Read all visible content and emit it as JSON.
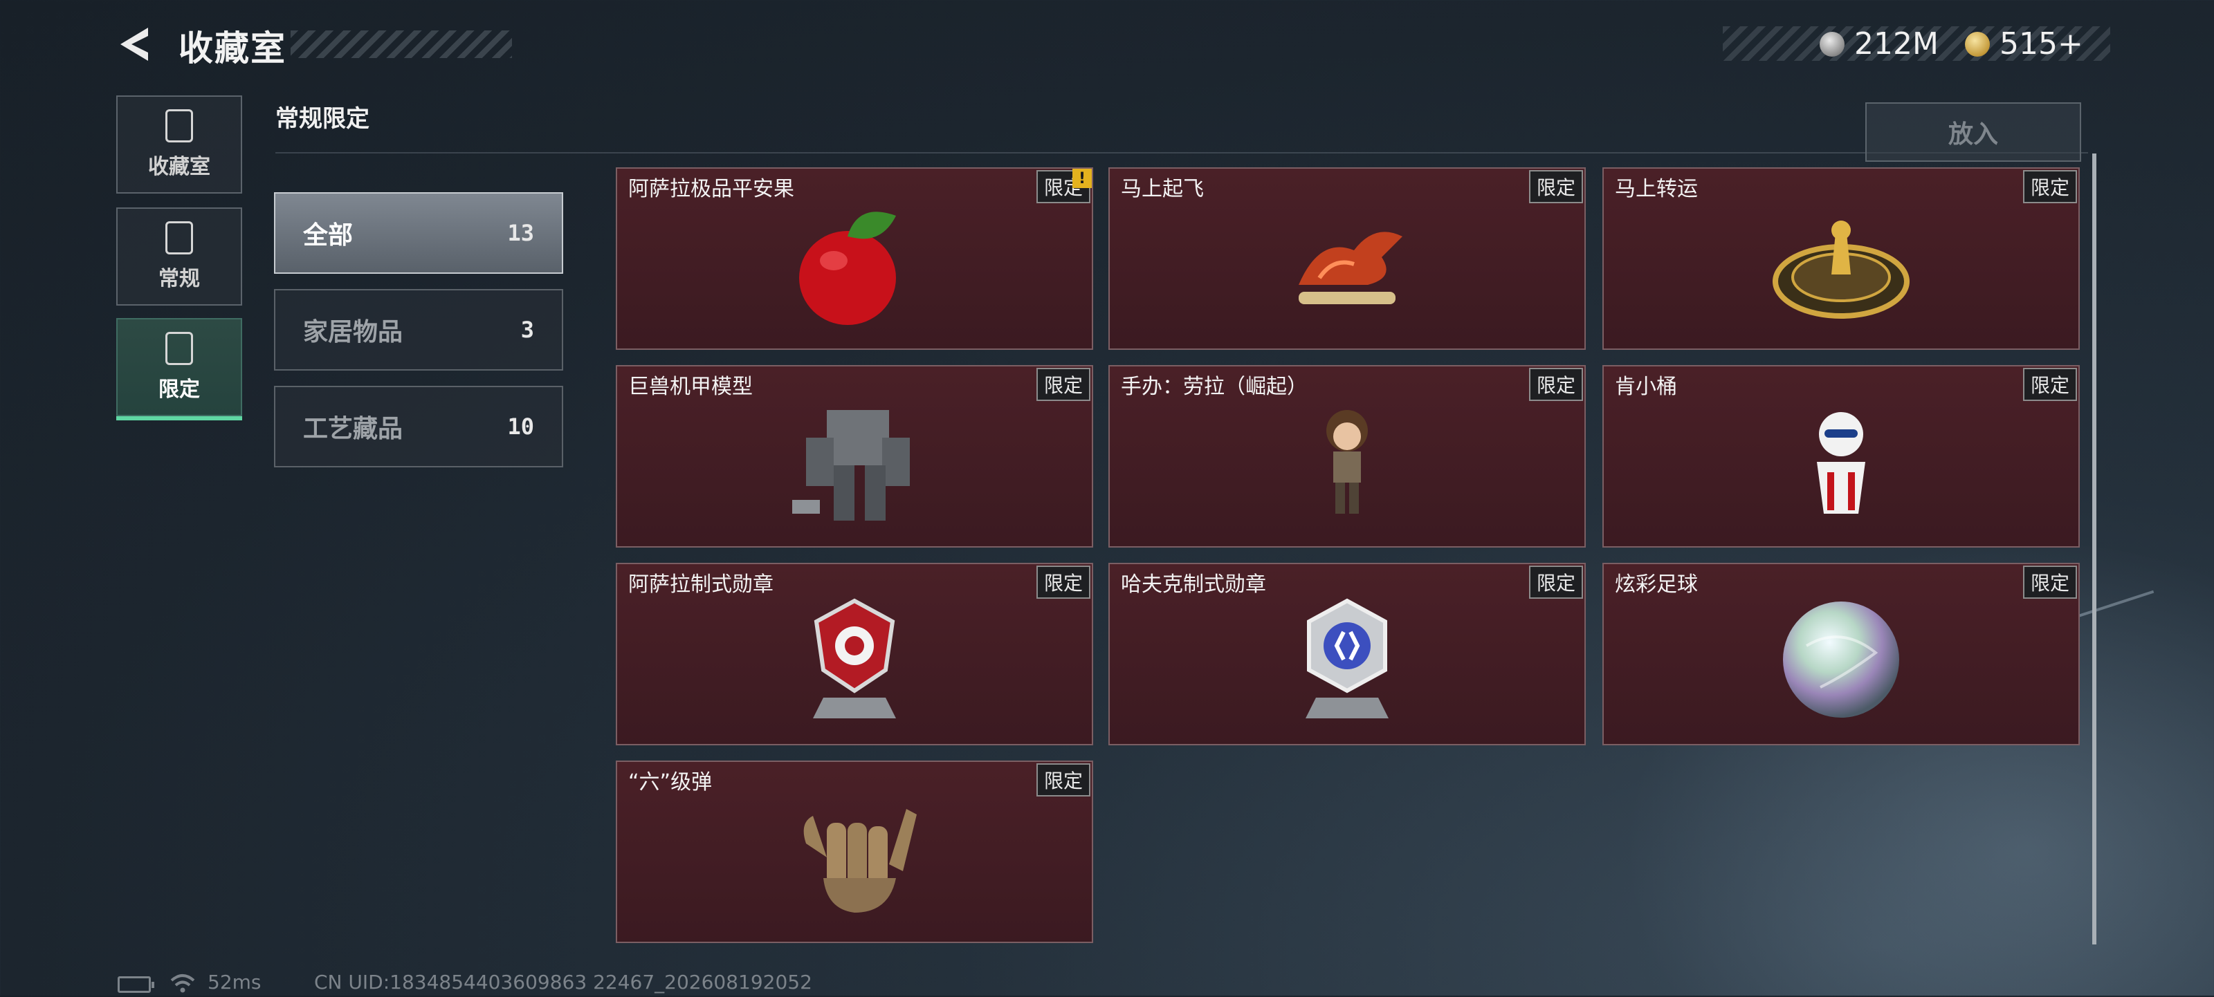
{
  "header": {
    "title": "收藏室",
    "currencies": [
      {
        "icon": "silver-coin-icon",
        "value": "212M"
      },
      {
        "icon": "gold-coin-icon",
        "value": "515+"
      }
    ]
  },
  "nav": [
    {
      "label": "收藏室",
      "icon": "collection-room-icon",
      "active": false
    },
    {
      "label": "常规",
      "icon": "regular-icon",
      "active": false
    },
    {
      "label": "限定",
      "icon": "limited-icon",
      "active": true
    }
  ],
  "section": {
    "title": "常规限定",
    "put_in_label": "放入"
  },
  "categories": [
    {
      "name": "全部",
      "count": "13",
      "active": true
    },
    {
      "name": "家居物品",
      "count": "3",
      "active": false
    },
    {
      "name": "工艺藏品",
      "count": "10",
      "active": false
    }
  ],
  "items": [
    {
      "name": "阿萨拉极品平安果",
      "tag": "限定",
      "warning": "!",
      "icon": "apple-icon"
    },
    {
      "name": "马上起飞",
      "tag": "限定",
      "icon": "horse-statue-icon"
    },
    {
      "name": "马上转运",
      "tag": "限定",
      "icon": "fortune-wheel-icon"
    },
    {
      "name": "巨兽机甲模型",
      "tag": "限定",
      "icon": "mech-model-icon"
    },
    {
      "name": "手办：劳拉（崛起）",
      "tag": "限定",
      "icon": "figure-icon"
    },
    {
      "name": "肯小桶",
      "tag": "限定",
      "icon": "mascot-bucket-icon"
    },
    {
      "name": "阿萨拉制式勋章",
      "tag": "限定",
      "icon": "red-medal-icon"
    },
    {
      "name": "哈夫克制式勋章",
      "tag": "限定",
      "icon": "blue-medal-icon"
    },
    {
      "name": "炫彩足球",
      "tag": "限定",
      "icon": "iridescent-ball-icon"
    },
    {
      "name": "“六”级弹",
      "tag": "限定",
      "icon": "hand-gesture-icon"
    }
  ],
  "footer": {
    "ping": "52ms",
    "uid": "CN UID:1834854403609863 22467_202608192052"
  },
  "colors": {
    "accent": "#5fd7a3",
    "card_bg": "#4a2027",
    "warning": "#e4b21e"
  }
}
